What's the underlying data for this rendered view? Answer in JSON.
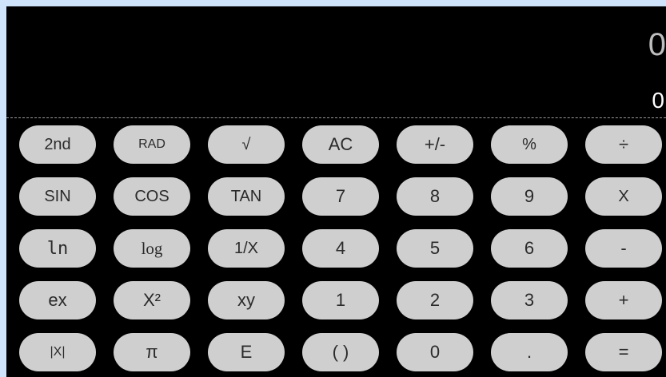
{
  "display": {
    "main_value": "0",
    "sub_value": "0"
  },
  "keys": {
    "second": "2nd",
    "rad": "RAD",
    "sqrt": "√",
    "ac": "AC",
    "plus_minus": "+/-",
    "percent": "%",
    "divide": "÷",
    "sin": "SIN",
    "cos": "COS",
    "tan": "TAN",
    "seven": "7",
    "eight": "8",
    "nine": "9",
    "multiply": "X",
    "ln": "ln",
    "log": "log",
    "reciprocal": "1/X",
    "four": "4",
    "five": "5",
    "six": "6",
    "minus": "-",
    "exp": "ex",
    "square": "X²",
    "power": "xy",
    "one": "1",
    "two": "2",
    "three": "3",
    "plus": "+",
    "abs": "|X|",
    "pi": "π",
    "e": "E",
    "parens": "( )",
    "zero": "0",
    "decimal": ".",
    "equals": "="
  },
  "colors": {
    "frame": "#cfe3fb",
    "background": "#000000",
    "key": "#cfcfcf",
    "key_text": "#2b2b2b"
  }
}
